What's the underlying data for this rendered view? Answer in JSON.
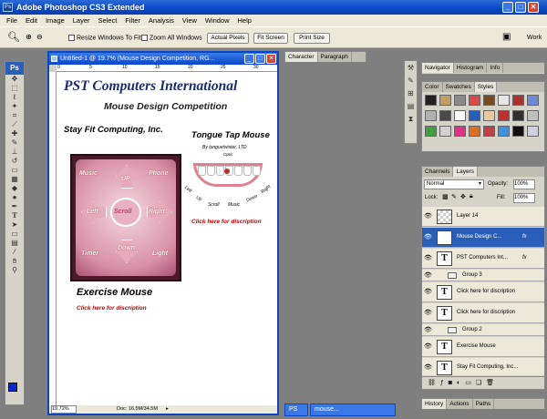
{
  "app": {
    "title": "Adobe Photoshop CS3 Extended",
    "logo": "Ps"
  },
  "menu": [
    "File",
    "Edit",
    "Image",
    "Layer",
    "Select",
    "Filter",
    "Analysis",
    "View",
    "Window",
    "Help"
  ],
  "options": {
    "resize_windows": "Resize Windows To Fit",
    "zoom_all": "Zoom All Windows",
    "actual_pixels": "Actual Pixels",
    "fit_screen": "Fit Screen",
    "print_size": "Print Size",
    "workspace": "Work"
  },
  "document": {
    "title": "Untitled-1 @ 19.7% (Mouse Design Competition, RG...",
    "zoom": "19.72%",
    "doc_size": "Doc: 16.5M/34.5M",
    "ruler_ticks": [
      "0",
      "5",
      "10",
      "15",
      "20",
      "25",
      "30"
    ]
  },
  "artwork": {
    "heading1": "PST Computers International",
    "heading2": "Mouse Design Competition",
    "company_left": "Stay Fit Computing, Inc.",
    "product_right": "Tongue Tap Mouse",
    "product_right_by": "By tonguetwister, LTD",
    "teeth_labels": [
      "Left",
      "Up",
      "Scroll",
      "Music",
      "Down",
      "Right"
    ],
    "optic": "Optic",
    "click_desc": "Click here for discription",
    "exercise": "Exercise Mouse",
    "keypad": [
      "Music",
      "UP",
      "Phone",
      "Left",
      "Scroll",
      "Right",
      "Timer",
      "Down",
      "Light"
    ]
  },
  "panels": {
    "char_tabs": [
      "Character",
      "Paragraph"
    ],
    "nav_tabs": [
      "Navigator",
      "Histogram",
      "Info"
    ],
    "style_tabs": [
      "Color",
      "Swatches",
      "Styles"
    ],
    "layer_tabs": [
      "Channels",
      "Layers"
    ],
    "blend": "Normal",
    "opacity_label": "Opacity:",
    "opacity": "100%",
    "lock_label": "Lock:",
    "fill_label": "Fill:",
    "fill": "100%",
    "bottom_tabs": [
      "History",
      "Actions",
      "Paths"
    ],
    "style_colors": [
      "#222222",
      "#c4a060",
      "#8a8a8a",
      "#d94a4a",
      "#7a4a20",
      "#e8e8e8",
      "#b03030",
      "#6a8ad8",
      "#b0b0b0",
      "#4a4a4a",
      "#ffffff",
      "#2060c0",
      "#e8c8a0",
      "#c03030",
      "#303030",
      "#c0c0c0",
      "#40a040",
      "#d0d0d0",
      "#e03080",
      "#e07020",
      "#c04040",
      "#4090e0",
      "#101010",
      "#d0d0e0"
    ]
  },
  "layers": [
    {
      "name": "Layer 14",
      "thumb": "",
      "type": "layer"
    },
    {
      "name": "Mouse Design C...",
      "thumb": "T",
      "type": "text",
      "fx": "fx",
      "selected": true
    },
    {
      "name": "PST Computers Int...",
      "thumb": "T",
      "type": "text",
      "fx": "fx"
    },
    {
      "name": "Group 3",
      "type": "group"
    },
    {
      "name": "Click here for discription",
      "thumb": "T",
      "type": "text"
    },
    {
      "name": "Click here for discription",
      "thumb": "T",
      "type": "text"
    },
    {
      "name": "Group 2",
      "type": "group"
    },
    {
      "name": "Exercise Mouse",
      "thumb": "T",
      "type": "text"
    },
    {
      "name": "Stay Fit Computing, Inc...",
      "thumb": "T",
      "type": "text"
    }
  ],
  "taskbar": {
    "item1": "PS",
    "item2": "mouse..."
  }
}
